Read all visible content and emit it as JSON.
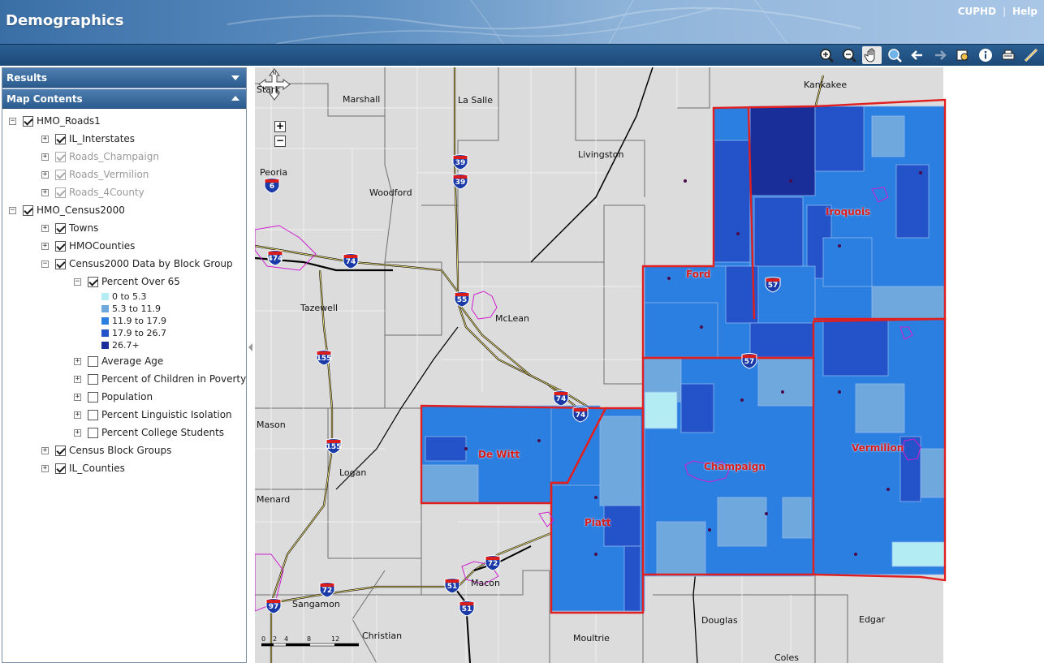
{
  "app": {
    "title": "Demographics"
  },
  "top_links": {
    "cuphd": "CUPHD",
    "help": "Help"
  },
  "toolbar": {
    "tools": [
      "zoom-in-icon",
      "zoom-out-icon",
      "pan-hand-icon",
      "full-extent-icon",
      "back-arrow-icon",
      "forward-arrow-icon",
      "select-icon",
      "identify-info-icon",
      "print-icon",
      "measure-icon"
    ]
  },
  "sidebar": {
    "results_label": "Results",
    "map_contents_label": "Map Contents",
    "tree": [
      {
        "label": "HMO_Roads1",
        "checked": true,
        "expander": "minus"
      },
      {
        "label": "IL_Interstates",
        "checked": true,
        "expander": "plus"
      },
      {
        "label": "Roads_Champaign",
        "checked": true,
        "dim": true,
        "expander": "plus"
      },
      {
        "label": "Roads_Vermilion",
        "checked": true,
        "dim": true,
        "expander": "plus"
      },
      {
        "label": "Roads_4County",
        "checked": true,
        "dim": true,
        "expander": "plus"
      },
      {
        "label": "HMO_Census2000",
        "checked": true,
        "expander": "minus"
      },
      {
        "label": "Towns",
        "checked": true,
        "expander": "plus"
      },
      {
        "label": "HMOCounties",
        "checked": true,
        "expander": "plus"
      },
      {
        "label": "Census2000 Data by Block Group",
        "checked": true,
        "expander": "minus"
      },
      {
        "label": "Percent Over 65",
        "checked": true,
        "expander": "minus"
      },
      {
        "label": "Average Age",
        "checked": false,
        "expander": "plus"
      },
      {
        "label": "Percent of Children in Poverty",
        "checked": false,
        "expander": "plus"
      },
      {
        "label": "Population",
        "checked": false,
        "expander": "plus"
      },
      {
        "label": "Percent Linguistic Isolation",
        "checked": false,
        "expander": "plus"
      },
      {
        "label": "Percent College Students",
        "checked": false,
        "expander": "plus"
      },
      {
        "label": "Census Block Groups",
        "checked": true,
        "expander": "plus"
      },
      {
        "label": "IL_Counties",
        "checked": true,
        "expander": "plus"
      }
    ],
    "legend": [
      {
        "label": "0 to 5.3",
        "color": "#b3ecf2"
      },
      {
        "label": "5.3 to 11.9",
        "color": "#6fa8dc"
      },
      {
        "label": "11.9 to 17.9",
        "color": "#2b7fe0"
      },
      {
        "label": "17.9 to 26.7",
        "color": "#2452c8"
      },
      {
        "label": "26.7+",
        "color": "#1a2e9a"
      }
    ]
  },
  "map": {
    "places": [
      "Stark",
      "Marshall",
      "La Salle",
      "Livingston",
      "Kankakee",
      "Peoria",
      "Woodford",
      "Tazewell",
      "McLean",
      "Mason",
      "Logan",
      "Menard",
      "Sangamon",
      "Macon",
      "Christian",
      "Moultrie",
      "Douglas",
      "Edgar",
      "Coles"
    ],
    "counties": [
      "Ford",
      "Iroquois",
      "De Witt",
      "Piatt",
      "Champaign",
      "Vermilion"
    ],
    "interstates": [
      "39",
      "39",
      "6",
      "474",
      "74",
      "55",
      "155",
      "57",
      "57",
      "74",
      "74",
      "155",
      "72",
      "72",
      "51",
      "51",
      "97"
    ],
    "scale_labels": [
      "0",
      "2",
      "4",
      "8",
      "12"
    ]
  }
}
